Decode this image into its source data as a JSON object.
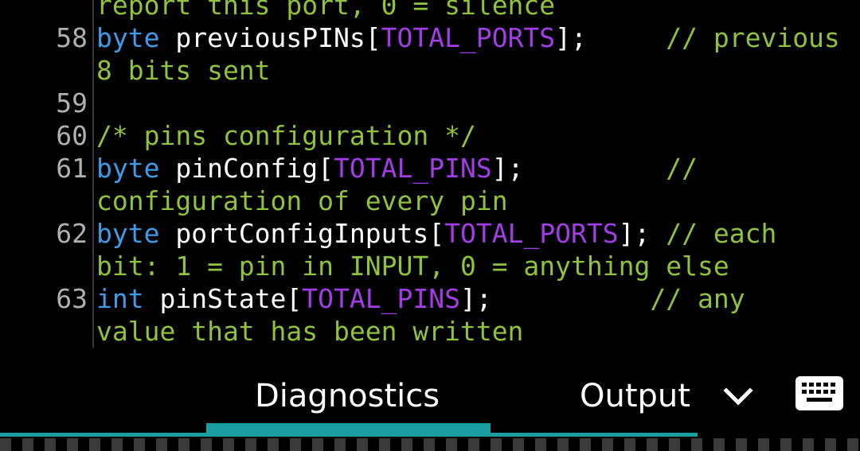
{
  "code": {
    "lines": [
      {
        "num": "",
        "segments": [
          {
            "t": "report this port, 0 = silence",
            "c": "cm"
          }
        ]
      },
      {
        "num": "58",
        "segments": [
          {
            "t": "byte ",
            "c": "kw"
          },
          {
            "t": "previousPINs[",
            "c": "id"
          },
          {
            "t": "TOTAL_PORTS",
            "c": "const"
          },
          {
            "t": "];     ",
            "c": "id"
          },
          {
            "t": "// previous",
            "c": "cm"
          }
        ]
      },
      {
        "num": "",
        "segments": [
          {
            "t": "8 bits sent",
            "c": "cm"
          }
        ]
      },
      {
        "num": "59",
        "segments": []
      },
      {
        "num": "60",
        "segments": [
          {
            "t": "/* pins configuration */",
            "c": "cm"
          }
        ]
      },
      {
        "num": "61",
        "segments": [
          {
            "t": "byte ",
            "c": "kw"
          },
          {
            "t": "pinConfig[",
            "c": "id"
          },
          {
            "t": "TOTAL_PINS",
            "c": "const"
          },
          {
            "t": "];         ",
            "c": "id"
          },
          {
            "t": "//",
            "c": "cm"
          }
        ]
      },
      {
        "num": "",
        "segments": [
          {
            "t": "configuration of every pin",
            "c": "cm"
          }
        ]
      },
      {
        "num": "62",
        "segments": [
          {
            "t": "byte ",
            "c": "kw"
          },
          {
            "t": "portConfigInputs[",
            "c": "id"
          },
          {
            "t": "TOTAL_PORTS",
            "c": "const"
          },
          {
            "t": "]; ",
            "c": "id"
          },
          {
            "t": "// each",
            "c": "cm"
          }
        ]
      },
      {
        "num": "",
        "segments": [
          {
            "t": "bit: 1 = pin in INPUT, 0 = anything else",
            "c": "cm"
          }
        ]
      },
      {
        "num": "63",
        "segments": [
          {
            "t": "int ",
            "c": "kw"
          },
          {
            "t": "pinState[",
            "c": "id"
          },
          {
            "t": "TOTAL_PINS",
            "c": "const"
          },
          {
            "t": "];          ",
            "c": "id"
          },
          {
            "t": "// any",
            "c": "cm"
          }
        ]
      },
      {
        "num": "",
        "segments": [
          {
            "t": "value that has been written",
            "c": "cm"
          }
        ]
      }
    ]
  },
  "tabs": {
    "diagnostics": "Diagnostics",
    "output": "Output"
  },
  "icons": {
    "collapse": "chevron-down-icon",
    "keyboard": "keyboard-icon"
  },
  "colors": {
    "keyword": "#3d9be9",
    "constant": "#a23de6",
    "comment": "#8fc23d",
    "accent": "#1a9ea0"
  }
}
